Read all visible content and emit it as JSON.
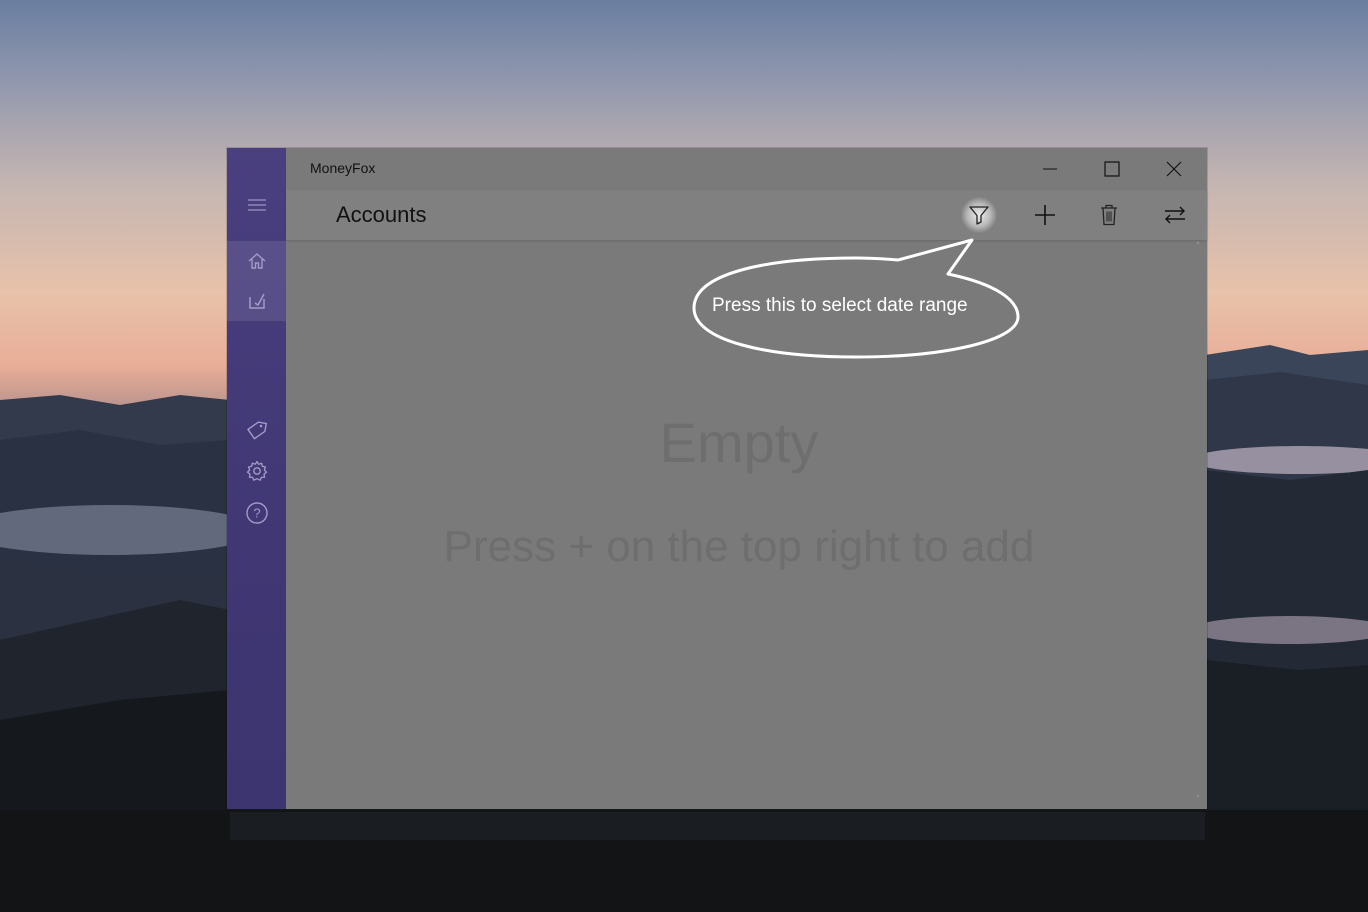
{
  "window": {
    "app_title": "MoneyFox",
    "page_title": "Accounts"
  },
  "caption_buttons": [
    "minimize-icon",
    "maximize-icon",
    "close-icon"
  ],
  "nav_rail": {
    "items": [
      "hamburger-menu-icon",
      "home-icon",
      "statistics-icon",
      "tag-icon",
      "settings-gear-icon",
      "help-icon"
    ],
    "selected": "home-icon"
  },
  "command_bar": {
    "buttons": [
      "filter-icon",
      "add-icon",
      "delete-icon",
      "transfer-icon"
    ],
    "highlighted": "filter-icon"
  },
  "empty_state": {
    "title": "Empty",
    "subtitle": "Press + on the top right to add"
  },
  "callout": {
    "text": "Press this to select date range"
  },
  "colors": {
    "nav_rail": "#433a78",
    "overlay": "#7a7a7a",
    "empty_text": "#6e6e6e"
  }
}
